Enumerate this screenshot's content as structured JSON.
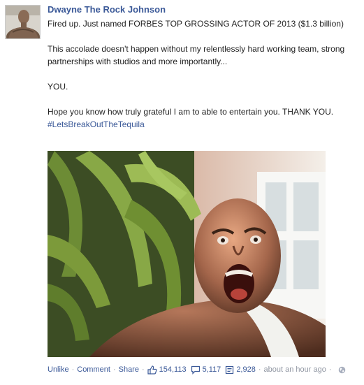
{
  "post": {
    "author": "Dwayne The Rock Johnson",
    "paragraphs": [
      "Fired up. Just named FORBES TOP GROSSING ACTOR OF 2013 ($1.3 billion)",
      "This accolade doesn't happen without my relentlessly hard working team, strong partnerships with studios and more importantly...",
      "YOU.",
      "Hope you know how truly grateful I am to able to entertain you. THANK YOU."
    ],
    "hashtag": "#LetsBreakOutTheTequila"
  },
  "actions": {
    "unlike": "Unlike",
    "comment": "Comment",
    "share": "Share",
    "likes_count": "154,113",
    "comments_count": "5,117",
    "shares_count": "2,928",
    "timestamp": "about an hour ago",
    "separator": "·"
  },
  "icons": {
    "like": "thumbs-up-icon",
    "comments": "speech-bubble-icon",
    "shares": "share-document-icon",
    "privacy": "globe-icon"
  },
  "colors": {
    "link": "#3b5998",
    "meta": "#9197a3"
  }
}
